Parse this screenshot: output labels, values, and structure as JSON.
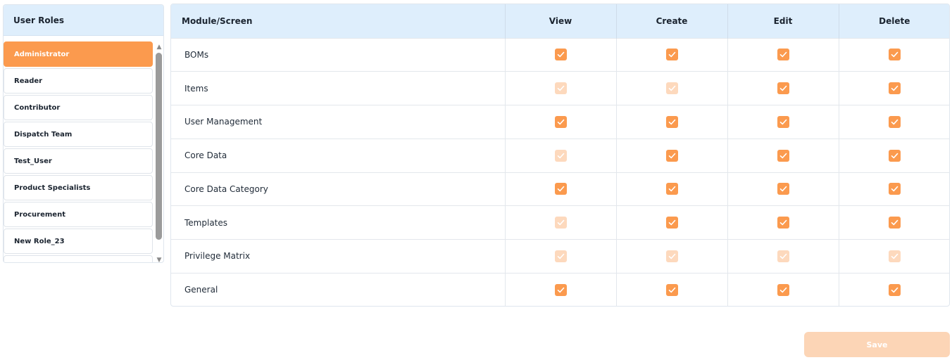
{
  "roles": {
    "header": "User Roles",
    "items": [
      {
        "label": "Administrator",
        "active": true
      },
      {
        "label": "Reader",
        "active": false
      },
      {
        "label": "Contributor",
        "active": false
      },
      {
        "label": "Dispatch Team",
        "active": false
      },
      {
        "label": "Test_User",
        "active": false
      },
      {
        "label": "Product Specialists",
        "active": false
      },
      {
        "label": "Procurement",
        "active": false
      },
      {
        "label": "New Role_23",
        "active": false
      }
    ]
  },
  "table": {
    "headers": {
      "module": "Module/Screen",
      "view": "View",
      "create": "Create",
      "edit": "Edit",
      "delete": "Delete"
    },
    "rows": [
      {
        "module": "BOMs",
        "view": true,
        "create": true,
        "edit": true,
        "delete": true
      },
      {
        "module": "Items",
        "view": false,
        "create": false,
        "edit": true,
        "delete": true
      },
      {
        "module": "User Management",
        "view": true,
        "create": true,
        "edit": true,
        "delete": true
      },
      {
        "module": "Core Data",
        "view": false,
        "create": true,
        "edit": true,
        "delete": true
      },
      {
        "module": "Core Data Category",
        "view": true,
        "create": true,
        "edit": true,
        "delete": true
      },
      {
        "module": "Templates",
        "view": false,
        "create": true,
        "edit": true,
        "delete": true
      },
      {
        "module": "Privilege Matrix",
        "view": false,
        "create": false,
        "edit": false,
        "delete": false
      },
      {
        "module": "General",
        "view": true,
        "create": true,
        "edit": true,
        "delete": true
      }
    ]
  },
  "save_label": "Save",
  "colors": {
    "accent": "#fb9a4e",
    "accent_disabled": "#fdd9bd",
    "header_bg": "#deeefc"
  }
}
